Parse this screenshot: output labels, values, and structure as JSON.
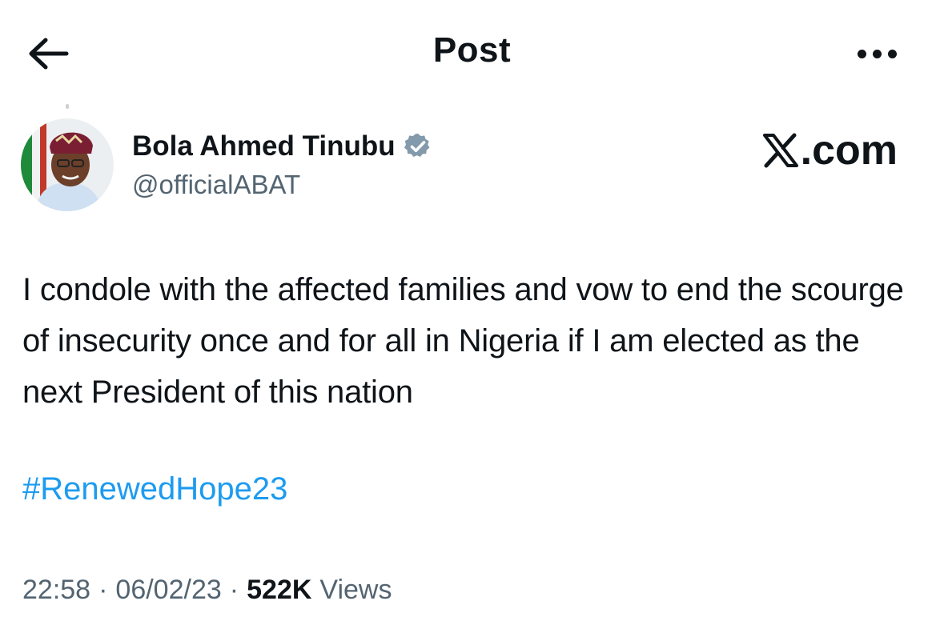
{
  "header": {
    "title": "Post",
    "back_icon": "arrow-left-icon",
    "more_icon": "more-horizontal-icon"
  },
  "author": {
    "name": "Bola Ahmed Tinubu",
    "handle": "@officialABAT",
    "verified": true,
    "verified_color": "#829aab"
  },
  "watermark": {
    "text": ".com",
    "logo": "x-logo-icon"
  },
  "post": {
    "text": "I condole with the affected families and vow to end the scourge of insecurity once and for all in Nigeria if I am elected as the next President of this nation",
    "hashtag": "#RenewedHope23",
    "hashtag_color": "#1d9bf0"
  },
  "meta": {
    "time": "22:58",
    "date": "06/02/23",
    "separator": "·",
    "views_count": "522K",
    "views_label": "Views"
  }
}
